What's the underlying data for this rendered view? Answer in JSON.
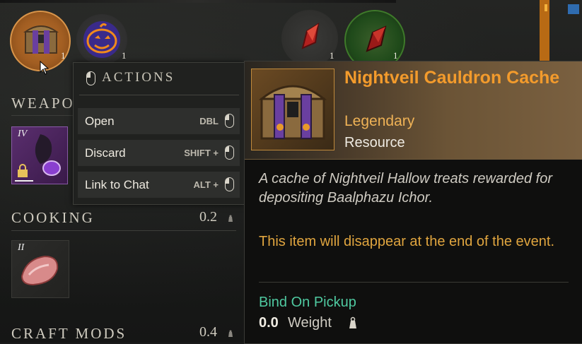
{
  "inventory_top": {
    "slots": [
      {
        "icon": "treasure-chest-icon",
        "quantity": "1",
        "selected": true
      },
      {
        "icon": "pumpkin-icon",
        "quantity": "1"
      },
      {
        "icon": "red-crystal-icon",
        "quantity": "1"
      },
      {
        "icon": "red-crystal-glow-icon",
        "quantity": "1"
      }
    ]
  },
  "sections": {
    "weapons": {
      "title": "WEAPO",
      "tier": "IV"
    },
    "cooking": {
      "title": "COOKING",
      "weight": "0.2",
      "tier": "II"
    },
    "craft_mods": {
      "title": "CRAFT MODS",
      "weight": "0.4"
    }
  },
  "actions_menu": {
    "title": "ACTIONS",
    "items": [
      {
        "label": "Open",
        "key": "DBL"
      },
      {
        "label": "Discard",
        "key": "SHIFT +"
      },
      {
        "label": "Link to Chat",
        "key": "ALT +"
      }
    ]
  },
  "tooltip": {
    "title": "Nightveil Cauldron Cache",
    "rarity": "Legendary",
    "type": "Resource",
    "description": "A cache of Nightveil Hallow treats rewarded for depositing Baalphazu Ichor.",
    "event_note": "This item will disappear at the end of the event.",
    "bind": "Bind On Pickup",
    "weight_value": "0.0",
    "weight_label": "Weight"
  },
  "colors": {
    "legendary": "#efb256",
    "title": "#f39b2c",
    "bind": "#4fc9a0",
    "note": "#e0a53f"
  }
}
